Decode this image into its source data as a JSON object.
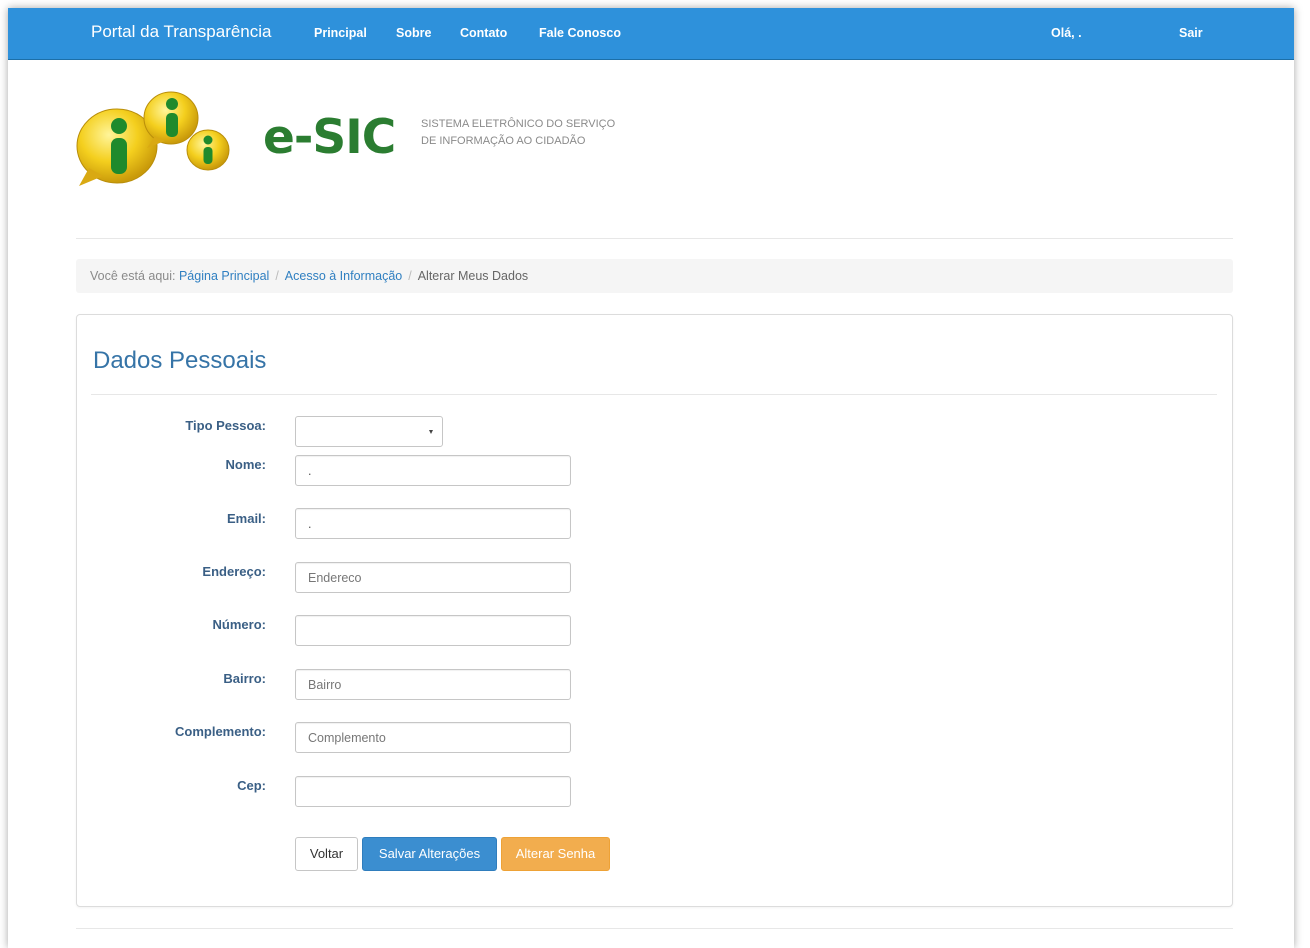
{
  "navbar": {
    "brand": "Portal da Transparência",
    "links": [
      "Principal",
      "Sobre",
      "Contato",
      "Fale Conosco"
    ],
    "greeting": "Olá, .",
    "logout": "Sair",
    "color": "#2e91db"
  },
  "logo": {
    "icon": "info-bubbles-icon",
    "title": "e-SIC",
    "tagline": "SISTEMA ELETRÔNICO DO SERVIÇO DE INFORMAÇÃO AO CIDADÃO",
    "title_color": "#2b7d31"
  },
  "breadcrumb": {
    "prefix": "Você está aqui:",
    "items": [
      "Página Principal",
      "Acesso à Informação"
    ],
    "active": "Alterar Meus Dados"
  },
  "form": {
    "title": "Dados Pessoais",
    "fields": {
      "tipo_pessoa": {
        "label": "Tipo Pessoa:",
        "value": ""
      },
      "nome": {
        "label": "Nome:",
        "value": "."
      },
      "email": {
        "label": "Email:",
        "value": "."
      },
      "endereco": {
        "label": "Endereço:",
        "placeholder": "Endereco"
      },
      "numero": {
        "label": "Número:",
        "placeholder": ""
      },
      "bairro": {
        "label": "Bairro:",
        "placeholder": "Bairro"
      },
      "complemento": {
        "label": "Complemento:",
        "placeholder": "Complemento"
      },
      "cep": {
        "label": "Cep:",
        "placeholder": ""
      }
    },
    "buttons": {
      "voltar": "Voltar",
      "salvar": "Salvar Alterações",
      "alterar_senha": "Alterar Senha"
    }
  }
}
